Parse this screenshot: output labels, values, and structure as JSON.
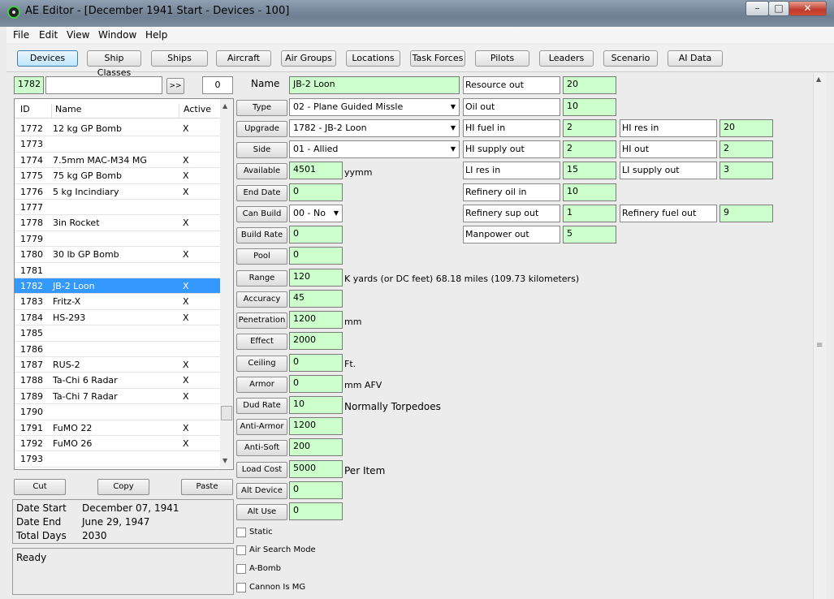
{
  "window": {
    "title": "AE Editor - [December 1941 Start - Devices - 100]",
    "min": "–",
    "max": "□",
    "close": "✕"
  },
  "menu": [
    "File",
    "Edit",
    "View",
    "Window",
    "Help"
  ],
  "toolbar": [
    "Devices",
    "Ship Classes",
    "Ships",
    "Aircraft",
    "Air Groups",
    "Locations",
    "Task Forces",
    "Pilots",
    "Leaders",
    "Scenario",
    "AI Data"
  ],
  "search": {
    "id": "1782",
    "text": "",
    "go": ">>",
    "count": "0"
  },
  "list": {
    "headers": {
      "id": "ID",
      "name": "Name",
      "active": "Active"
    },
    "rows": [
      {
        "id": "1772",
        "name": "12 kg GP Bomb",
        "active": "X"
      },
      {
        "id": "1773",
        "name": "",
        "active": ""
      },
      {
        "id": "1774",
        "name": "7.5mm MAC-M34 MG",
        "active": "X"
      },
      {
        "id": "1775",
        "name": "75 kg GP Bomb",
        "active": "X"
      },
      {
        "id": "1776",
        "name": "5 kg Incindiary",
        "active": "X"
      },
      {
        "id": "1777",
        "name": "",
        "active": ""
      },
      {
        "id": "1778",
        "name": "3in Rocket",
        "active": "X"
      },
      {
        "id": "1779",
        "name": "",
        "active": ""
      },
      {
        "id": "1780",
        "name": "30 lb GP Bomb",
        "active": "X"
      },
      {
        "id": "1781",
        "name": "",
        "active": ""
      },
      {
        "id": "1782",
        "name": "JB-2 Loon",
        "active": "X"
      },
      {
        "id": "1783",
        "name": "Fritz-X",
        "active": "X"
      },
      {
        "id": "1784",
        "name": "HS-293",
        "active": "X"
      },
      {
        "id": "1785",
        "name": "",
        "active": ""
      },
      {
        "id": "1786",
        "name": "",
        "active": ""
      },
      {
        "id": "1787",
        "name": "RUS-2",
        "active": "X"
      },
      {
        "id": "1788",
        "name": "Ta-Chi 6 Radar",
        "active": "X"
      },
      {
        "id": "1789",
        "name": "Ta-Chi 7 Radar",
        "active": "X"
      },
      {
        "id": "1790",
        "name": "",
        "active": ""
      },
      {
        "id": "1791",
        "name": "FuMO 22",
        "active": "X"
      },
      {
        "id": "1792",
        "name": "FuMO 26",
        "active": "X"
      },
      {
        "id": "1793",
        "name": "",
        "active": ""
      }
    ],
    "selected": "1782"
  },
  "actions": {
    "cut": "Cut",
    "copy": "Copy",
    "paste": "Paste"
  },
  "dates": {
    "start_label": "Date Start",
    "start": "December 07, 1941",
    "end_label": "Date End",
    "end": "June 29, 1947",
    "days_label": "Total Days",
    "days": "2030"
  },
  "status": "Ready",
  "form": {
    "name_label": "Name",
    "name": "JB-2 Loon",
    "type_label": "Type",
    "type": "02 - Plane Guided Missle",
    "upgrade_label": "Upgrade",
    "upgrade": "1782 - JB-2 Loon",
    "side_label": "Side",
    "side": "01 - Allied",
    "available_label": "Available",
    "available": "4501",
    "available_unit": "yymm",
    "enddate_label": "End Date",
    "enddate": "0",
    "canbuild_label": "Can Build",
    "canbuild": "00 - No",
    "buildrate_label": "Build Rate",
    "buildrate": "0",
    "pool_label": "Pool",
    "pool": "0",
    "range_label": "Range",
    "range": "120",
    "range_unit": "K yards  (or DC feet)  68.18 miles  (109.73 kilometers)",
    "accuracy_label": "Accuracy",
    "accuracy": "45",
    "penetration_label": "Penetration",
    "penetration": "1200",
    "penetration_unit": "mm",
    "effect_label": "Effect",
    "effect": "2000",
    "ceiling_label": "Ceiling",
    "ceiling": "0",
    "ceiling_unit": "Ft.",
    "armor_label": "Armor",
    "armor": "0",
    "armor_unit": "mm AFV",
    "dudrate_label": "Dud Rate",
    "dudrate": "10",
    "dudrate_unit": "Normally Torpedoes",
    "antiarmor_label": "Anti-Armor",
    "antiarmor": "1200",
    "antisoft_label": "Anti-Soft",
    "antisoft": "200",
    "loadcost_label": "Load Cost",
    "loadcost": "5000",
    "loadcost_unit": "Per Item",
    "altdevice_label": "Alt Device",
    "altdevice": "0",
    "altuse_label": "Alt Use",
    "altuse": "0",
    "static_label": "Static",
    "airsearch_label": "Air Search Mode",
    "abomb_label": "A-Bomb",
    "cannonmg_label": "Cannon Is MG"
  },
  "resources": {
    "resource_out_label": "Resource out",
    "resource_out": "20",
    "oil_out_label": "Oil out",
    "oil_out": "10",
    "hi_fuel_in_label": "HI fuel in",
    "hi_fuel_in": "2",
    "hi_res_in_label": "HI res in",
    "hi_res_in": "20",
    "hi_supply_out_label": "HI supply out",
    "hi_supply_out": "2",
    "hi_out_label": "HI out",
    "hi_out": "2",
    "li_res_in_label": "LI res in",
    "li_res_in": "15",
    "li_supply_out_label": "LI supply out",
    "li_supply_out": "3",
    "ref_oil_in_label": "Refinery oil in",
    "ref_oil_in": "10",
    "ref_sup_out_label": "Refinery sup out",
    "ref_sup_out": "1",
    "ref_fuel_out_label": "Refinery fuel out",
    "ref_fuel_out": "9",
    "manpower_out_label": "Manpower out",
    "manpower_out": "5"
  }
}
